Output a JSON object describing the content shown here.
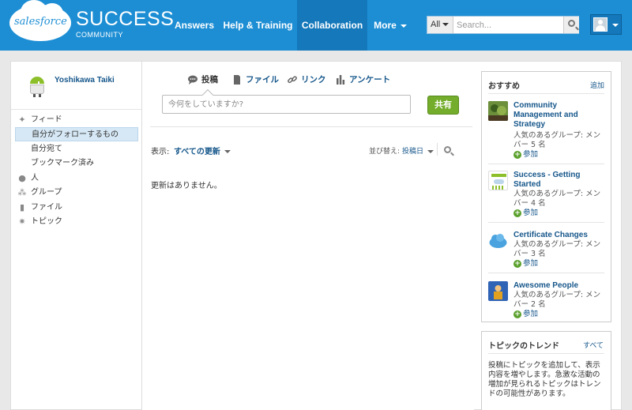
{
  "header": {
    "logo_text": "salesforce",
    "brand_title": "SUCCESS",
    "brand_subtitle": "COMMUNITY",
    "nav": [
      {
        "label": "Answers"
      },
      {
        "label": "Help & Training"
      },
      {
        "label": "Collaboration",
        "active": true
      },
      {
        "label": "More"
      }
    ],
    "search": {
      "scope": "All",
      "placeholder": "Search..."
    }
  },
  "sidebar": {
    "profile_name": "Yoshikawa Taiki",
    "items": [
      {
        "label": "フィード",
        "icon": "feed-icon"
      },
      {
        "label": "自分がフォローするもの",
        "selected": true
      },
      {
        "label": "自分宛て"
      },
      {
        "label": "ブックマーク済み"
      },
      {
        "label": "人",
        "icon": "person-icon"
      },
      {
        "label": "グループ",
        "icon": "group-icon"
      },
      {
        "label": "ファイル",
        "icon": "file-icon"
      },
      {
        "label": "トピック",
        "icon": "topic-icon"
      }
    ]
  },
  "publisher": {
    "tabs": [
      {
        "label": "投稿",
        "icon": "post-icon"
      },
      {
        "label": "ファイル",
        "icon": "file-icon"
      },
      {
        "label": "リンク",
        "icon": "link-icon"
      },
      {
        "label": "アンケート",
        "icon": "poll-icon"
      }
    ],
    "placeholder": "今何をしていますか?",
    "share_label": "共有"
  },
  "feed": {
    "show_label": "表示:",
    "filter_value": "すべての更新",
    "sort_label": "並び替え:",
    "sort_value": "投稿日",
    "empty_message": "更新はありません。"
  },
  "recommendations": {
    "title": "おすすめ",
    "add_label": "追加",
    "items": [
      {
        "name": "Community Management and Strategy",
        "meta": "人気のあるグループ: メンバー 5 名",
        "join_label": "参加"
      },
      {
        "name": "Success - Getting Started",
        "meta": "人気のあるグループ: メンバー 4 名",
        "join_label": "参加"
      },
      {
        "name": "Certificate Changes",
        "meta": "人気のあるグループ: メンバー 3 名",
        "join_label": "参加"
      },
      {
        "name": "Awesome People",
        "meta": "人気のあるグループ: メンバー 2 名",
        "join_label": "参加"
      }
    ]
  },
  "trending": {
    "title": "トピックのトレンド",
    "all_label": "すべて",
    "text": "投稿にトピックを追加して、表示内容を増やします。急激な活動の増加が見られるトピックはトレンドの可能性があります。"
  },
  "colors": {
    "header": "#1d8ed4",
    "link": "#15568a",
    "share": "#73ad2b"
  }
}
